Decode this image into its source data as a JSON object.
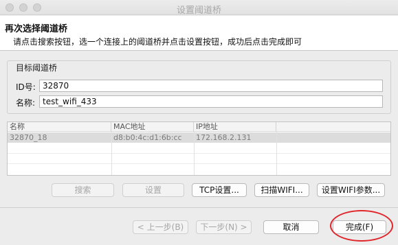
{
  "window": {
    "title": "设置阈道桥"
  },
  "header": {
    "title": "再次选择阈道桥",
    "description": "请点击搜索按钮，选一个连接上的阈道桥并点击设置按钮，成功后点击完成即可"
  },
  "target_group": {
    "title": "目标阈道桥",
    "id_label": "ID号:",
    "id_value": "32870",
    "name_label": "名称:",
    "name_value": "test_wifi_433"
  },
  "table": {
    "columns": [
      "名称",
      "MAC地址",
      "IP地址",
      ""
    ],
    "rows": [
      {
        "name": "32870_18",
        "mac": "d8:b0:4c:d1:6b:cc",
        "ip": "172.168.2.131",
        "extra": ""
      }
    ]
  },
  "actions": {
    "search": "搜索",
    "settings": "设置",
    "tcp_settings": "TCP设置...",
    "scan_wifi": "扫描WIFI...",
    "wifi_params": "设置WIFI参数..."
  },
  "footer": {
    "back": "< 上一步(B)",
    "next": "下一步(N) >",
    "cancel": "取消",
    "finish": "完成(F)"
  },
  "colors": {
    "highlight_ring": "#e0262a",
    "selected_row": "#dcdcdc"
  }
}
